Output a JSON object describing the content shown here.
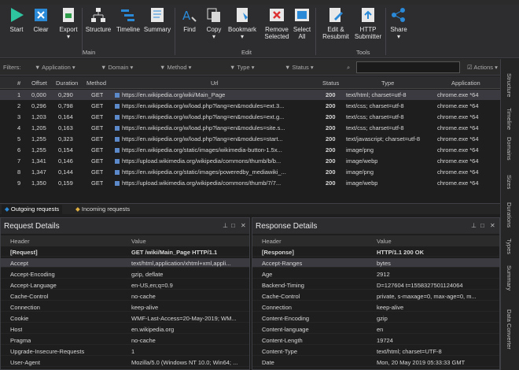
{
  "ribbon": {
    "start": "Start",
    "clear": "Clear",
    "export": "Export",
    "structure": "Structure",
    "timeline": "Timeline",
    "summary": "Summary",
    "main_group": "Main",
    "find": "Find",
    "copy": "Copy",
    "bookmark": "Bookmark",
    "remove_selected": "Remove Selected",
    "select_all": "Select All",
    "edit_group": "Edit",
    "edit_resubmit": "Edit & Resubmit",
    "http_submitter": "HTTP Submitter",
    "tools_group": "Tools",
    "share": "Share"
  },
  "filters": {
    "label": "Filters:",
    "application": "Application",
    "domain": "Domain",
    "method": "Method",
    "type": "Type",
    "status": "Status",
    "actions": "Actions"
  },
  "grid": {
    "headers": [
      "#",
      "Offset",
      "Duration",
      "Method",
      "Url",
      "Status",
      "Type",
      "Application"
    ],
    "rows": [
      {
        "n": "1",
        "offset": "0,000",
        "duration": "0,290",
        "method": "GET",
        "url": "https://en.wikipedia.org/wiki/Main_Page",
        "status": "200",
        "type": "text/html; charset=utf-8",
        "app": "chrome.exe *64"
      },
      {
        "n": "2",
        "offset": "0,296",
        "duration": "0,798",
        "method": "GET",
        "url": "https://en.wikipedia.org/w/load.php?lang=en&modules=ext.3...",
        "status": "200",
        "type": "text/css; charset=utf-8",
        "app": "chrome.exe *64"
      },
      {
        "n": "3",
        "offset": "1,203",
        "duration": "0,164",
        "method": "GET",
        "url": "https://en.wikipedia.org/w/load.php?lang=en&modules=ext.g...",
        "status": "200",
        "type": "text/css; charset=utf-8",
        "app": "chrome.exe *64"
      },
      {
        "n": "4",
        "offset": "1,205",
        "duration": "0,163",
        "method": "GET",
        "url": "https://en.wikipedia.org/w/load.php?lang=en&modules=site.s...",
        "status": "200",
        "type": "text/css; charset=utf-8",
        "app": "chrome.exe *64"
      },
      {
        "n": "5",
        "offset": "1,255",
        "duration": "0,323",
        "method": "GET",
        "url": "https://en.wikipedia.org/w/load.php?lang=en&modules=start...",
        "status": "200",
        "type": "text/javascript; charset=utf-8",
        "app": "chrome.exe *64"
      },
      {
        "n": "6",
        "offset": "1,255",
        "duration": "0,154",
        "method": "GET",
        "url": "https://en.wikipedia.org/static/images/wikimedia-button-1.5x...",
        "status": "200",
        "type": "image/png",
        "app": "chrome.exe *64"
      },
      {
        "n": "7",
        "offset": "1,341",
        "duration": "0,146",
        "method": "GET",
        "url": "https://upload.wikimedia.org/wikipedia/commons/thumb/b/b...",
        "status": "200",
        "type": "image/webp",
        "app": "chrome.exe *64"
      },
      {
        "n": "8",
        "offset": "1,347",
        "duration": "0,144",
        "method": "GET",
        "url": "https://en.wikipedia.org/static/images/poweredby_mediawiki_...",
        "status": "200",
        "type": "image/png",
        "app": "chrome.exe *64"
      },
      {
        "n": "9",
        "offset": "1,350",
        "duration": "0,159",
        "method": "GET",
        "url": "https://upload.wikimedia.org/wikipedia/commons/thumb/7/7...",
        "status": "200",
        "type": "image/webp",
        "app": "chrome.exe *64"
      }
    ]
  },
  "tabs": {
    "outgoing": "Outgoing requests",
    "incoming": "Incoming requests"
  },
  "request": {
    "title": "Request Details",
    "header_col": "Header",
    "value_col": "Value",
    "rows": [
      {
        "h": "[Request]",
        "v": "GET /wiki/Main_Page HTTP/1.1"
      },
      {
        "h": "Accept",
        "v": "text/html,application/xhtml+xml,appli..."
      },
      {
        "h": "Accept-Encoding",
        "v": "gzip, deflate"
      },
      {
        "h": "Accept-Language",
        "v": "en-US,en;q=0.9"
      },
      {
        "h": "Cache-Control",
        "v": "no-cache"
      },
      {
        "h": "Connection",
        "v": "keep-alive"
      },
      {
        "h": "Cookie",
        "v": "WMF-Last-Access=20-May-2019; WM..."
      },
      {
        "h": "Host",
        "v": "en.wikipedia.org"
      },
      {
        "h": "Pragma",
        "v": "no-cache"
      },
      {
        "h": "Upgrade-Insecure-Requests",
        "v": "1"
      },
      {
        "h": "User-Agent",
        "v": "Mozilla/5.0 (Windows NT 10.0; Win64; ..."
      }
    ]
  },
  "response": {
    "title": "Response Details",
    "header_col": "Header",
    "value_col": "Value",
    "rows": [
      {
        "h": "[Response]",
        "v": "HTTP/1.1 200 OK"
      },
      {
        "h": "Accept-Ranges",
        "v": "bytes"
      },
      {
        "h": "Age",
        "v": "2912"
      },
      {
        "h": "Backend-Timing",
        "v": "D=127604 t=1558327501124064"
      },
      {
        "h": "Cache-Control",
        "v": "private, s-maxage=0, max-age=0, m..."
      },
      {
        "h": "Connection",
        "v": "keep-alive"
      },
      {
        "h": "Content-Encoding",
        "v": "gzip"
      },
      {
        "h": "Content-language",
        "v": "en"
      },
      {
        "h": "Content-Length",
        "v": "19724"
      },
      {
        "h": "Content-Type",
        "v": "text/html; charset=UTF-8"
      },
      {
        "h": "Date",
        "v": "Mon, 20 May 2019 05:33:33 GMT"
      }
    ]
  },
  "side": {
    "structure": "Structure",
    "timeline": "Timeline",
    "domains": "Domains",
    "sizes": "Sizes",
    "durations": "Durations",
    "types": "Types",
    "summary": "Summary",
    "data_converter": "Data Converter"
  }
}
